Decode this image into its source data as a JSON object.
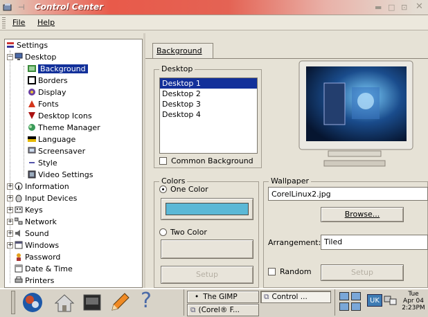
{
  "window": {
    "title": "Control Center"
  },
  "menu": {
    "file": "File",
    "help": "Help"
  },
  "tree": {
    "root": "Settings",
    "items": [
      {
        "label": "Desktop"
      },
      {
        "label": "Background"
      },
      {
        "label": "Borders"
      },
      {
        "label": "Display"
      },
      {
        "label": "Fonts"
      },
      {
        "label": "Desktop Icons"
      },
      {
        "label": "Theme Manager"
      },
      {
        "label": "Language"
      },
      {
        "label": "Screensaver"
      },
      {
        "label": "Style"
      },
      {
        "label": "Video Settings"
      },
      {
        "label": "Information"
      },
      {
        "label": "Input Devices"
      },
      {
        "label": "Keys"
      },
      {
        "label": "Network"
      },
      {
        "label": "Sound"
      },
      {
        "label": "Windows"
      },
      {
        "label": "Password"
      },
      {
        "label": "Date & Time"
      },
      {
        "label": "Printers"
      }
    ]
  },
  "tabs": {
    "background": "Background"
  },
  "desktop_group": {
    "title": "Desktop",
    "items": [
      "Desktop 1",
      "Desktop 2",
      "Desktop 3",
      "Desktop 4"
    ],
    "common_bg": "Common Background"
  },
  "colors_group": {
    "title": "Colors",
    "one_color": "One Color",
    "two_color": "Two Color",
    "one_color_swatch": "#5bb8d6",
    "setup": "Setup"
  },
  "wallpaper_group": {
    "title": "Wallpaper",
    "file": "CorelLinux2.jpg",
    "browse": "Browse...",
    "arrangement_label": "Arrangement:",
    "arrangement_value": "Tiled",
    "random": "Random",
    "setup": "Setup"
  },
  "taskbar": {
    "tasks": [
      "The GIMP",
      "Control ...",
      "(Corel® F..."
    ],
    "keyboard": "UK",
    "clock_day": "Tue",
    "clock_date": "Apr 04",
    "clock_time": "2:23PM"
  }
}
